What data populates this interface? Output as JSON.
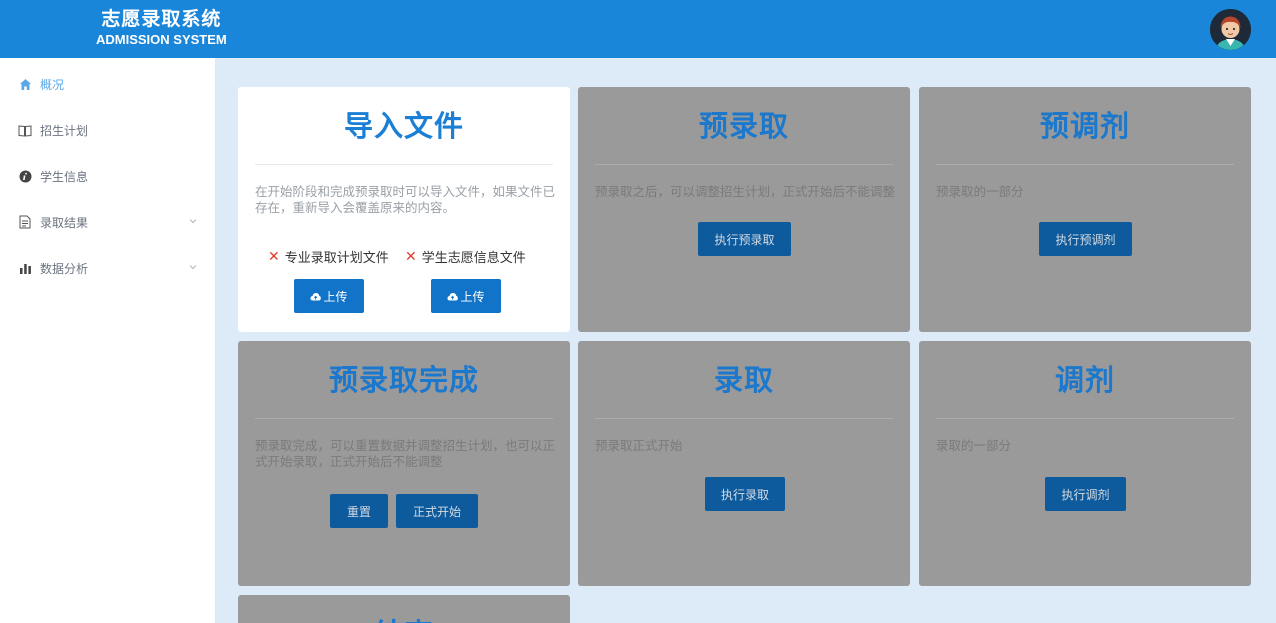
{
  "header": {
    "title_cn": "志愿录取系统",
    "title_en": "ADMISSION SYSTEM"
  },
  "sidebar": {
    "items": [
      {
        "label": "概况",
        "icon": "home-icon",
        "active": true
      },
      {
        "label": "招生计划",
        "icon": "book-icon"
      },
      {
        "label": "学生信息",
        "icon": "info-icon"
      },
      {
        "label": "录取结果",
        "icon": "document-icon",
        "expandable": true
      },
      {
        "label": "数据分析",
        "icon": "bar-chart-icon",
        "expandable": true
      }
    ]
  },
  "cards": {
    "import": {
      "title": "导入文件",
      "desc": "在开始阶段和完成预录取时可以导入文件，如果文件已存在，重新导入会覆盖原来的内容。",
      "file1": "专业录取计划文件",
      "file2": "学生志愿信息文件",
      "upload1": "上传",
      "upload2": "上传"
    },
    "pre_admit": {
      "title": "预录取",
      "desc": "预录取之后，可以调整招生计划，正式开始后不能调整",
      "button": "执行预录取"
    },
    "pre_adjust": {
      "title": "预调剂",
      "desc": "预录取的一部分",
      "button": "执行预调剂"
    },
    "pre_done": {
      "title": "预录取完成",
      "desc": "预录取完成，可以重置数据并调整招生计划，也可以正式开始录取，正式开始后不能调整",
      "reset": "重置",
      "start": "正式开始"
    },
    "admit": {
      "title": "录取",
      "desc": "预录取正式开始",
      "button": "执行录取"
    },
    "adjust": {
      "title": "调剂",
      "desc": "录取的一部分",
      "button": "执行调剂"
    },
    "end": {
      "title": "结束"
    }
  },
  "colors": {
    "header": "#1a86d9",
    "accent": "#1274c9",
    "disabled_card": "#9a9a9a",
    "background": "#dcebf7",
    "status_missing": "#e03a2e"
  }
}
